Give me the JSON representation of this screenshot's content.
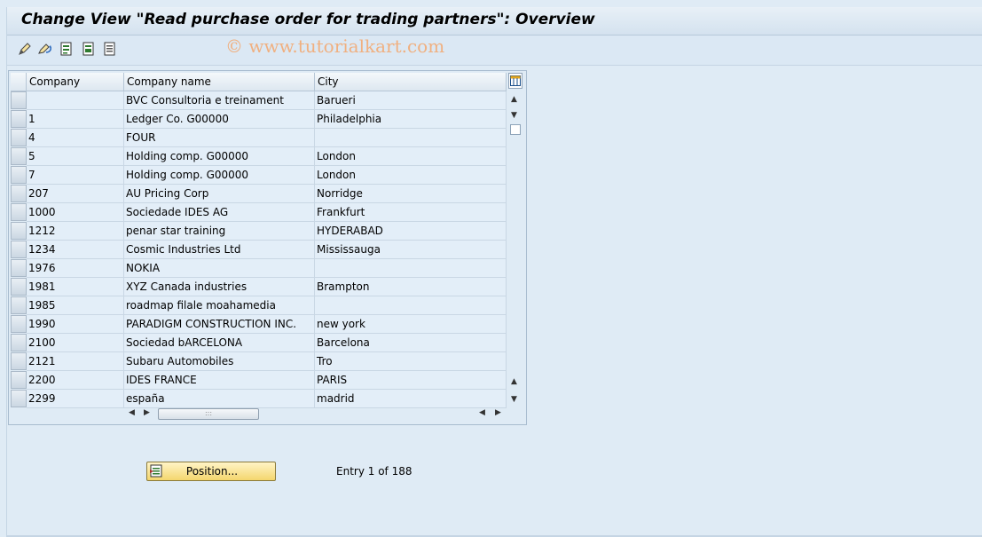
{
  "window": {
    "title": "Change View \"Read purchase order for trading partners\": Overview"
  },
  "toolbar": {
    "watermark": "© www.tutorialkart.com",
    "buttons": [
      {
        "name": "display-change-icon"
      },
      {
        "name": "undo-change-icon"
      },
      {
        "name": "select-all-icon"
      },
      {
        "name": "select-block-icon"
      },
      {
        "name": "deselect-all-icon"
      }
    ]
  },
  "table": {
    "columns": [
      "Company",
      "Company name",
      "City"
    ],
    "rows": [
      {
        "company": "",
        "name": "BVC Consultoria e treinament",
        "city": "Barueri"
      },
      {
        "company": "1",
        "name": "Ledger Co. G00000",
        "city": "Philadelphia"
      },
      {
        "company": "4",
        "name": "FOUR",
        "city": ""
      },
      {
        "company": "5",
        "name": "Holding comp. G00000",
        "city": "London"
      },
      {
        "company": "7",
        "name": "Holding comp. G00000",
        "city": "London"
      },
      {
        "company": "207",
        "name": "AU Pricing Corp",
        "city": "Norridge"
      },
      {
        "company": "1000",
        "name": "Sociedade IDES AG",
        "city": "Frankfurt"
      },
      {
        "company": "1212",
        "name": "penar star training",
        "city": "HYDERABAD"
      },
      {
        "company": "1234",
        "name": "Cosmic Industries Ltd",
        "city": "Mississauga"
      },
      {
        "company": "1976",
        "name": "NOKIA",
        "city": ""
      },
      {
        "company": "1981",
        "name": "XYZ Canada industries",
        "city": "Brampton"
      },
      {
        "company": "1985",
        "name": "roadmap filale moahamedia",
        "city": ""
      },
      {
        "company": "1990",
        "name": "PARADIGM CONSTRUCTION INC.",
        "city": "new york"
      },
      {
        "company": "2100",
        "name": "Sociedad bARCELONA",
        "city": "Barcelona"
      },
      {
        "company": "2121",
        "name": "Subaru Automobiles",
        "city": "Tro"
      },
      {
        "company": "2200",
        "name": "IDES FRANCE",
        "city": "PARIS"
      },
      {
        "company": "2299",
        "name": "españa",
        "city": "madrid"
      }
    ]
  },
  "footer": {
    "position_label": "Position...",
    "entry_text": "Entry 1 of 188"
  },
  "colors": {
    "background": "#dfebf5",
    "cell": "#e3eef8",
    "button": "#f4d66e"
  }
}
